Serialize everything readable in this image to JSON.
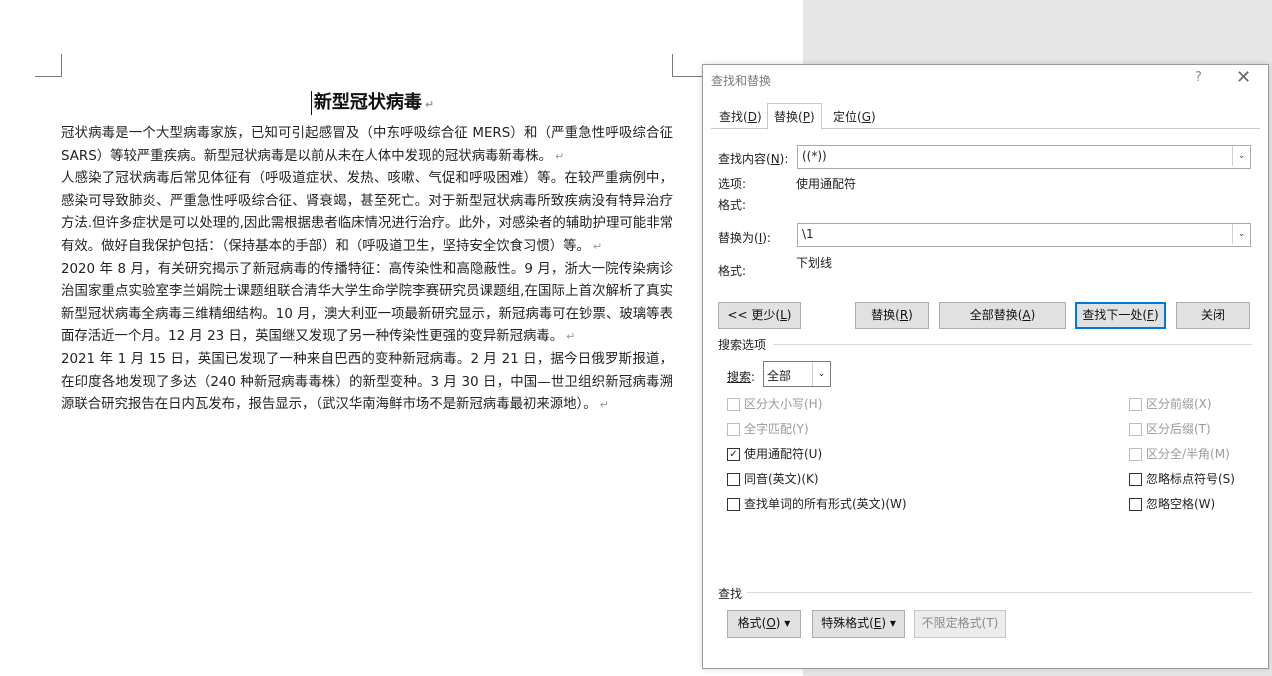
{
  "document": {
    "title": "新型冠状病毒",
    "pilcrow": "↵",
    "paragraphs": [
      "冠状病毒是一个大型病毒家族，已知可引起感冒及（中东呼吸综合征 MERS）和（严重急性呼吸综合征 SARS）等较严重疾病。新型冠状病毒是以前从未在人体中发现的冠状病毒新毒株。",
      "人感染了冠状病毒后常见体征有（呼吸道症状、发热、咳嗽、气促和呼吸困难）等。在较严重病例中，感染可导致肺炎、严重急性呼吸综合征、肾衰竭，甚至死亡。对于新型冠状病毒所致疾病没有特异治疗方法.但许多症状是可以处理的,因此需根据患者临床情况进行治疗。此外，对感染者的辅助护理可能非常有效。做好自我保护包括：（保持基本的手部）和（呼吸道卫生，坚持安全饮食习惯）等。",
      "2020 年 8 月，有关研究揭示了新冠病毒的传播特征：高传染性和高隐蔽性。9 月，浙大一院传染病诊治国家重点实验室李兰娟院士课题组联合清华大学生命学院李赛研究员课题组,在国际上首次解析了真实新型冠状病毒全病毒三维精细结构。10 月，澳大利亚一项最新研究显示，新冠病毒可在钞票、玻璃等表面存活近一个月。12 月 23 日，英国继又发现了另一种传染性更强的变异新冠病毒。",
      "2021 年 1 月 15 日，英国已发现了一种来自巴西的变种新冠病毒。2 月 21 日，据今日俄罗斯报道，在印度各地发现了多达（240 种新冠病毒毒株）的新型变种。3 月 30 日，中国—世卫组织新冠病毒溯源联合研究报告在日内瓦发布，报告显示，（武汉华南海鲜市场不是新冠病毒最初来源地）。"
    ]
  },
  "dialog": {
    "title": "查找和替换",
    "help": "?",
    "close": "✕",
    "tabs": {
      "find": {
        "text": "查找(",
        "key": "D",
        "end": ")"
      },
      "replace": {
        "text": "替换(",
        "key": "P",
        "end": ")"
      },
      "goto": {
        "text": "定位(",
        "key": "G",
        "end": ")"
      }
    },
    "find_label": {
      "text": "查找内容(",
      "key": "N",
      "end": "):"
    },
    "find_value": "((*))",
    "options_label": "选项:",
    "options_value": "使用通配符",
    "format_label1": "格式:",
    "replace_label": {
      "text": "替换为(",
      "key": "I",
      "end": "):"
    },
    "replace_value": "\\1",
    "format_label2": "格式:",
    "format_value2": "下划线",
    "buttons": {
      "less": {
        "text": "<< 更少(",
        "key": "L",
        "end": ")"
      },
      "replace": {
        "text": "替换(",
        "key": "R",
        "end": ")"
      },
      "replace_all": {
        "text": "全部替换(",
        "key": "A",
        "end": ")"
      },
      "find_next": {
        "text": "查找下一处(",
        "key": "F",
        "end": ")"
      },
      "close": "关闭"
    },
    "search_options_title": "搜索选项",
    "search_label": {
      "text": "搜索",
      "key": "",
      "end": ":"
    },
    "search_value": "全部",
    "checkboxes_left": [
      {
        "label": "区分大小写(H)",
        "checked": false,
        "disabled": true
      },
      {
        "label": "全字匹配(Y)",
        "checked": false,
        "disabled": true
      },
      {
        "label": "使用通配符(U)",
        "checked": true,
        "disabled": false
      },
      {
        "label": "同音(英文)(K)",
        "checked": false,
        "disabled": false
      },
      {
        "label": "查找单词的所有形式(英文)(W)",
        "checked": false,
        "disabled": false
      }
    ],
    "checkboxes_right": [
      {
        "label": "区分前缀(X)",
        "checked": false,
        "disabled": true
      },
      {
        "label": "区分后缀(T)",
        "checked": false,
        "disabled": true
      },
      {
        "label": "区分全/半角(M)",
        "checked": false,
        "disabled": true
      },
      {
        "label": "忽略标点符号(S)",
        "checked": false,
        "disabled": false
      },
      {
        "label": "忽略空格(W)",
        "checked": false,
        "disabled": false
      }
    ],
    "find_section_title": "查找",
    "bottom_buttons": {
      "format": {
        "text": "格式(",
        "key": "O",
        "end": ") ▾"
      },
      "special": {
        "text": "特殊格式(",
        "key": "E",
        "end": ") ▾"
      },
      "no_format": "不限定格式(T)"
    },
    "check_mark": "✓",
    "arrow": "⌄"
  }
}
